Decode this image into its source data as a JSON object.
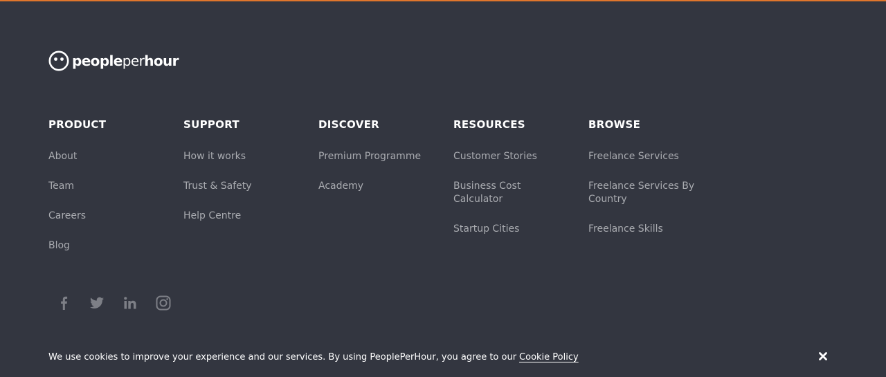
{
  "colors": {
    "background": "#333640",
    "accent_border": "#e0762c",
    "heading": "#ffffff",
    "link": "#a9abb0",
    "social_icon": "#7d7f86"
  },
  "logo": {
    "part1": "people",
    "part2": "per",
    "part3": "hour",
    "icon": "smiley-logo-icon"
  },
  "columns": [
    {
      "title": "PRODUCT",
      "links": [
        "About",
        "Team",
        "Careers",
        "Blog"
      ]
    },
    {
      "title": "SUPPORT",
      "links": [
        "How it works",
        "Trust & Safety",
        "Help Centre"
      ]
    },
    {
      "title": "DISCOVER",
      "links": [
        "Premium Programme",
        "Academy"
      ]
    },
    {
      "title": "RESOURCES",
      "links": [
        "Customer Stories",
        "Business Cost Calculator",
        "Startup Cities"
      ]
    },
    {
      "title": "BROWSE",
      "links": [
        "Freelance Services",
        "Freelance Services By Country",
        "Freelance Skills"
      ]
    }
  ],
  "social": [
    "facebook-icon",
    "twitter-icon",
    "linkedin-icon",
    "instagram-icon"
  ],
  "cookie": {
    "text": "We use cookies to improve your experience and our services. By using PeoplePerHour, you agree to our",
    "link": "Cookie Policy",
    "close_icon": "close-icon"
  }
}
